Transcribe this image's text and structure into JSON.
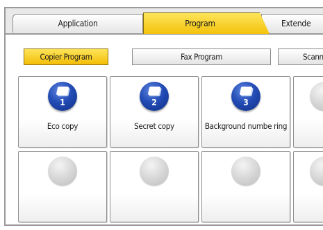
{
  "tabs": {
    "application": "Application",
    "program": "Program",
    "extended": "Extende"
  },
  "subtabs": {
    "copier": "Copier Program",
    "fax": "Fax Program",
    "scanner": "Scanne"
  },
  "programs": [
    {
      "number": "1",
      "name": "Eco copy"
    },
    {
      "number": "2",
      "name": "Secret copy"
    },
    {
      "number": "3",
      "name": "Background numbe ring"
    }
  ],
  "colors": {
    "selected": "#f4c20c",
    "badge": "#234cb5"
  }
}
